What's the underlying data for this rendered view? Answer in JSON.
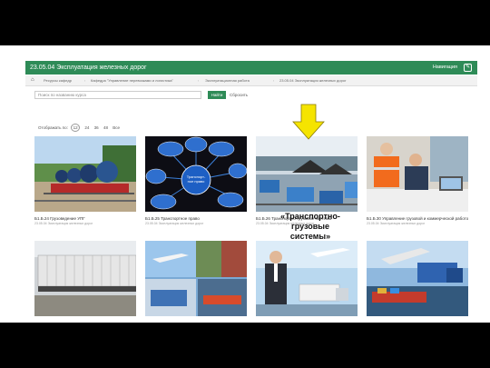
{
  "header": {
    "title": "23.05.04 Эксплуатация железных дорог",
    "nav_label": "Навигация"
  },
  "breadcrumbs": [
    "Ресурсы кафедр",
    "Кафедра \"Управление перевозками и логистика\"",
    "Эксплуатационная работа",
    "23.05.04 Эксплуатация железных дорог"
  ],
  "search": {
    "placeholder": "Поиск по названию курса",
    "find_label": "Найти",
    "reset_label": "Сбросить"
  },
  "paging": {
    "label": "Отображать по:",
    "selected": "12",
    "options": [
      "24",
      "36",
      "48",
      "Все"
    ]
  },
  "courses": [
    {
      "title": "Б1.Б.24 Грузоведение УПГ",
      "sub": "23.05.04 Эксплуатация железных дорог"
    },
    {
      "title": "Б1.Б.25 Транспортное право",
      "sub": "23.05.04 Эксплуатация железных дорог"
    },
    {
      "title": "Б1.Б.26 Транспортно-грузовые системы",
      "sub": "23.05.04 Эксплуатация железных дорог"
    },
    {
      "title": "Б1.Б.30 Управление грузовой и коммерческой работой",
      "sub": "23.05.04 Эксплуатация железных дорог"
    },
    {
      "title": "",
      "sub": ""
    },
    {
      "title": "",
      "sub": ""
    },
    {
      "title": "",
      "sub": ""
    },
    {
      "title": "",
      "sub": ""
    }
  ],
  "annotation": {
    "line1": "«Транспортно-",
    "line2": "грузовые",
    "line3": "системы»"
  },
  "colors": {
    "header": "#2e8b57",
    "arrow": "#f5e400"
  }
}
